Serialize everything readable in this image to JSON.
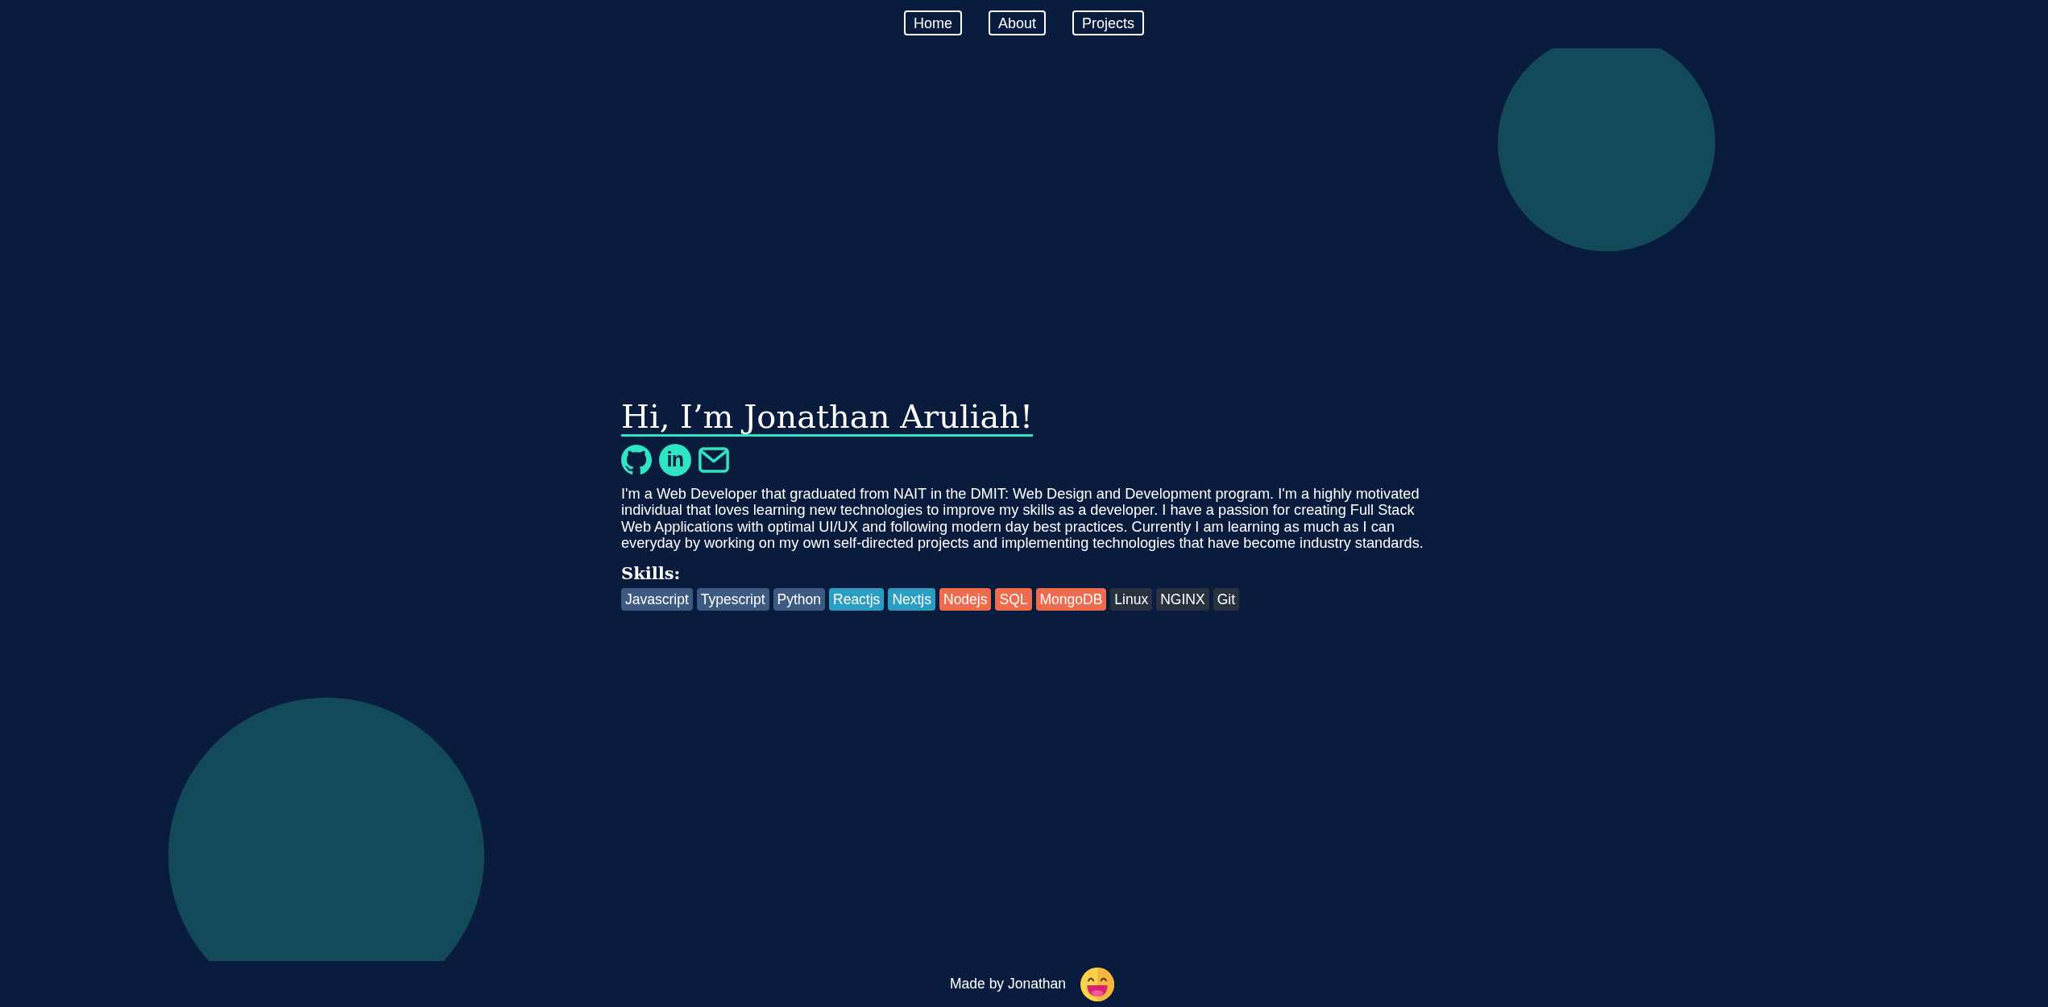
{
  "nav": {
    "links": [
      "Home",
      "About",
      "Projects"
    ]
  },
  "hero": {
    "title": "Hi, I’m Jonathan Aruliah!",
    "social_links": [
      {
        "kind": "github"
      },
      {
        "kind": "linkedin",
        "text": "in"
      },
      {
        "kind": "email"
      }
    ],
    "bio": "I'm a Web Developer that graduated from NAIT in the DMIT: Web Design and Development program. I'm a highly motivated individual that loves learning new technologies to improve my skills as a developer. I have a passion for creating Full Stack Web Applications with optimal UI/UX and following modern day best practices. Currently I am learning as much as I can everyday by working on my own self-directed projects and implementing technologies that have become industry standards.",
    "skills_heading": "Skills:",
    "skills": [
      {
        "label": "Javascript",
        "color": "#3d5a80"
      },
      {
        "label": "Typescript",
        "color": "#3d5a80"
      },
      {
        "label": "Python",
        "color": "#3d5a80"
      },
      {
        "label": "Reactjs",
        "color": "#2a9dc0"
      },
      {
        "label": "Nextjs",
        "color": "#2a9dc0"
      },
      {
        "label": "Nodejs",
        "color": "#ee6c4d"
      },
      {
        "label": "SQL",
        "color": "#ee6c4d"
      },
      {
        "label": "MongoDB",
        "color": "#ee6c4d"
      },
      {
        "label": "Linux",
        "color": "#293241"
      },
      {
        "label": "NGINX",
        "color": "#293241"
      },
      {
        "label": "Git",
        "color": "#293241"
      }
    ]
  },
  "footer": {
    "text": "Made by Jonathan"
  }
}
